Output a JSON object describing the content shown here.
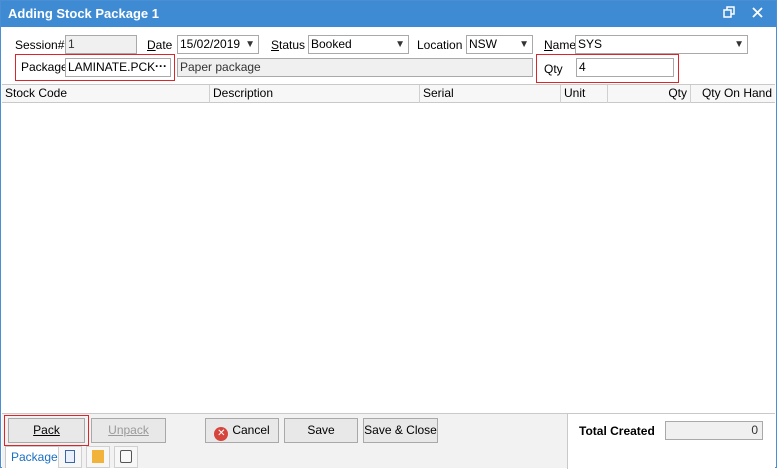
{
  "window": {
    "title": "Adding Stock Package 1",
    "restore_icon": "restore-icon",
    "close_icon": "close-icon"
  },
  "form": {
    "session_label": "Session#",
    "session_value": "1",
    "date_label": "Date",
    "date_value": "15/02/2019",
    "status_label": "Status",
    "status_value": "Booked",
    "location_label": "Location",
    "location_value": "NSW",
    "name_label": "Name",
    "name_value": "SYS",
    "package_label": "Package",
    "package_value": "LAMINATE.PCK",
    "package_ellipsis": "···",
    "package_description": "Paper package",
    "qty_label": "Qty",
    "qty_value": "4"
  },
  "grid": {
    "columns": [
      "Stock Code",
      "Description",
      "Serial",
      "Unit",
      "Qty",
      "Qty On Hand"
    ],
    "rows": []
  },
  "buttons": {
    "pack": "Pack",
    "unpack": "Unpack",
    "cancel": "Cancel",
    "save": "Save",
    "save_close": "Save & Close"
  },
  "totals": {
    "label": "Total Created",
    "value": "0"
  },
  "tabs": {
    "package": "Package"
  },
  "colors": {
    "titlebar": "#3f8bd3",
    "highlight": "#d9262a",
    "tab_active": "#1a6fc2"
  }
}
